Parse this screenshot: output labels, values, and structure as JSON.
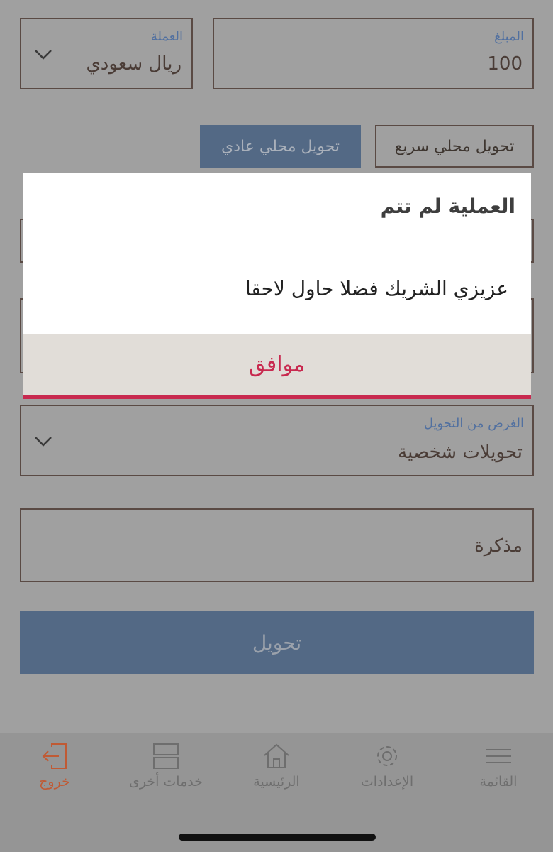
{
  "amount": {
    "label": "المبلغ",
    "value": "100"
  },
  "currency": {
    "label": "العملة",
    "value": "ريال سعودي",
    "icon": "chevron-down-icon"
  },
  "transfer_types": {
    "fast": "تحويل محلي سريع",
    "normal": "تحويل محلي عادي",
    "active": "normal"
  },
  "purpose": {
    "label": "الغرض من التحويل",
    "value": "تحويلات شخصية",
    "icon": "chevron-down-icon"
  },
  "note": {
    "placeholder": "مذكرة"
  },
  "submit": {
    "label": "تحويل"
  },
  "dialog": {
    "title": "العملية لم تتم",
    "message": "عزيزي الشريك فضلا حاول لاحقا",
    "ok_label": "موافق",
    "accent_color": "#c8294f"
  },
  "bottom_nav": {
    "items": [
      {
        "label": "خروج",
        "icon": "logout-icon",
        "color": "#c05a34"
      },
      {
        "label": "خدمات أخرى",
        "icon": "services-icon"
      },
      {
        "label": "الرئيسية",
        "icon": "home-icon"
      },
      {
        "label": "الإعدادات",
        "icon": "gear-icon"
      },
      {
        "label": "القائمة",
        "icon": "menu-icon"
      }
    ]
  },
  "colors": {
    "overlay_bg": "#a0a0a0",
    "label_blue": "#5170a0",
    "active_tab": "#536985",
    "submit_bg": "#536985"
  }
}
